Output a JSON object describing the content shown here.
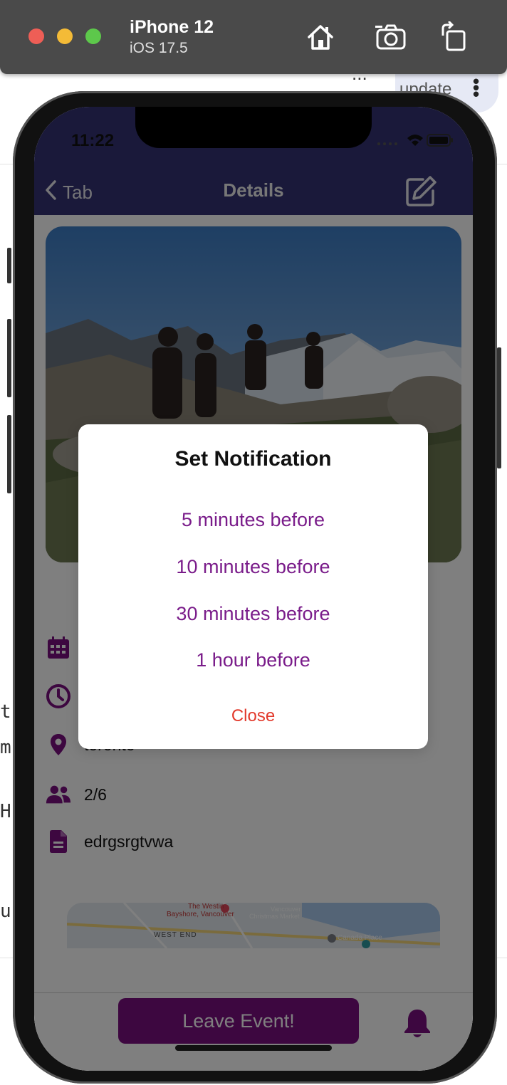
{
  "simulator": {
    "device_name": "iPhone 12",
    "os_version": "iOS 17.5",
    "home_icon": "home-icon",
    "screenshot_icon": "camera-icon",
    "rotate_icon": "rotate-icon"
  },
  "background": {
    "update_label": "update",
    "ellipsis": "...",
    "stray_chars": [
      "t",
      "m",
      "H",
      "u"
    ]
  },
  "status_bar": {
    "time": "11:22"
  },
  "nav": {
    "back_label": "Tab",
    "title": "Details",
    "edit_icon": "edit-icon"
  },
  "event": {
    "location": "toronto",
    "attendees": "2/6",
    "description": "edrgsrgtvwa",
    "map_labels": [
      "The Westin",
      "Bayshore, Vancouver",
      "Vancouver",
      "Christmas Market",
      "WEST END",
      "Canada Place"
    ]
  },
  "bottom_bar": {
    "leave_label": "Leave Event!",
    "bell_icon": "bell-icon"
  },
  "dialog": {
    "title": "Set Notification",
    "options": [
      "5 minutes before",
      "10 minutes before",
      "30 minutes before",
      "1 hour before"
    ],
    "close_label": "Close"
  },
  "colors": {
    "nav_bg": "#343275",
    "accent_purple": "#7b0f80",
    "option_text": "#7a1c8a",
    "close_text": "#e23a2c"
  }
}
